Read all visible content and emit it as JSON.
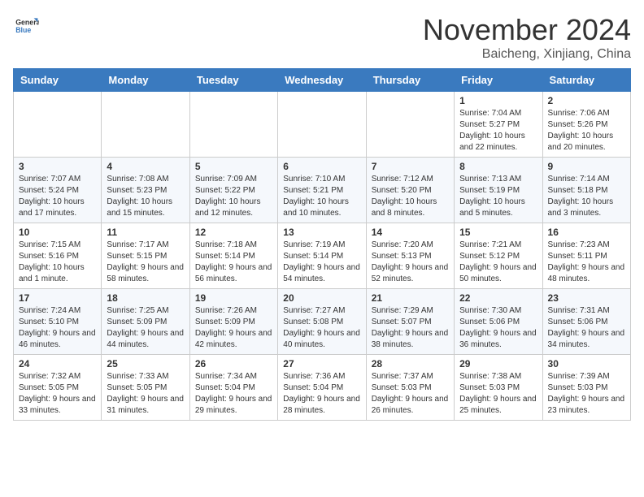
{
  "header": {
    "logo_general": "General",
    "logo_blue": "Blue",
    "month_title": "November 2024",
    "location": "Baicheng, Xinjiang, China"
  },
  "days_of_week": [
    "Sunday",
    "Monday",
    "Tuesday",
    "Wednesday",
    "Thursday",
    "Friday",
    "Saturday"
  ],
  "weeks": [
    [
      {
        "day": "",
        "info": ""
      },
      {
        "day": "",
        "info": ""
      },
      {
        "day": "",
        "info": ""
      },
      {
        "day": "",
        "info": ""
      },
      {
        "day": "",
        "info": ""
      },
      {
        "day": "1",
        "info": "Sunrise: 7:04 AM\nSunset: 5:27 PM\nDaylight: 10 hours and 22 minutes."
      },
      {
        "day": "2",
        "info": "Sunrise: 7:06 AM\nSunset: 5:26 PM\nDaylight: 10 hours and 20 minutes."
      }
    ],
    [
      {
        "day": "3",
        "info": "Sunrise: 7:07 AM\nSunset: 5:24 PM\nDaylight: 10 hours and 17 minutes."
      },
      {
        "day": "4",
        "info": "Sunrise: 7:08 AM\nSunset: 5:23 PM\nDaylight: 10 hours and 15 minutes."
      },
      {
        "day": "5",
        "info": "Sunrise: 7:09 AM\nSunset: 5:22 PM\nDaylight: 10 hours and 12 minutes."
      },
      {
        "day": "6",
        "info": "Sunrise: 7:10 AM\nSunset: 5:21 PM\nDaylight: 10 hours and 10 minutes."
      },
      {
        "day": "7",
        "info": "Sunrise: 7:12 AM\nSunset: 5:20 PM\nDaylight: 10 hours and 8 minutes."
      },
      {
        "day": "8",
        "info": "Sunrise: 7:13 AM\nSunset: 5:19 PM\nDaylight: 10 hours and 5 minutes."
      },
      {
        "day": "9",
        "info": "Sunrise: 7:14 AM\nSunset: 5:18 PM\nDaylight: 10 hours and 3 minutes."
      }
    ],
    [
      {
        "day": "10",
        "info": "Sunrise: 7:15 AM\nSunset: 5:16 PM\nDaylight: 10 hours and 1 minute."
      },
      {
        "day": "11",
        "info": "Sunrise: 7:17 AM\nSunset: 5:15 PM\nDaylight: 9 hours and 58 minutes."
      },
      {
        "day": "12",
        "info": "Sunrise: 7:18 AM\nSunset: 5:14 PM\nDaylight: 9 hours and 56 minutes."
      },
      {
        "day": "13",
        "info": "Sunrise: 7:19 AM\nSunset: 5:14 PM\nDaylight: 9 hours and 54 minutes."
      },
      {
        "day": "14",
        "info": "Sunrise: 7:20 AM\nSunset: 5:13 PM\nDaylight: 9 hours and 52 minutes."
      },
      {
        "day": "15",
        "info": "Sunrise: 7:21 AM\nSunset: 5:12 PM\nDaylight: 9 hours and 50 minutes."
      },
      {
        "day": "16",
        "info": "Sunrise: 7:23 AM\nSunset: 5:11 PM\nDaylight: 9 hours and 48 minutes."
      }
    ],
    [
      {
        "day": "17",
        "info": "Sunrise: 7:24 AM\nSunset: 5:10 PM\nDaylight: 9 hours and 46 minutes."
      },
      {
        "day": "18",
        "info": "Sunrise: 7:25 AM\nSunset: 5:09 PM\nDaylight: 9 hours and 44 minutes."
      },
      {
        "day": "19",
        "info": "Sunrise: 7:26 AM\nSunset: 5:09 PM\nDaylight: 9 hours and 42 minutes."
      },
      {
        "day": "20",
        "info": "Sunrise: 7:27 AM\nSunset: 5:08 PM\nDaylight: 9 hours and 40 minutes."
      },
      {
        "day": "21",
        "info": "Sunrise: 7:29 AM\nSunset: 5:07 PM\nDaylight: 9 hours and 38 minutes."
      },
      {
        "day": "22",
        "info": "Sunrise: 7:30 AM\nSunset: 5:06 PM\nDaylight: 9 hours and 36 minutes."
      },
      {
        "day": "23",
        "info": "Sunrise: 7:31 AM\nSunset: 5:06 PM\nDaylight: 9 hours and 34 minutes."
      }
    ],
    [
      {
        "day": "24",
        "info": "Sunrise: 7:32 AM\nSunset: 5:05 PM\nDaylight: 9 hours and 33 minutes."
      },
      {
        "day": "25",
        "info": "Sunrise: 7:33 AM\nSunset: 5:05 PM\nDaylight: 9 hours and 31 minutes."
      },
      {
        "day": "26",
        "info": "Sunrise: 7:34 AM\nSunset: 5:04 PM\nDaylight: 9 hours and 29 minutes."
      },
      {
        "day": "27",
        "info": "Sunrise: 7:36 AM\nSunset: 5:04 PM\nDaylight: 9 hours and 28 minutes."
      },
      {
        "day": "28",
        "info": "Sunrise: 7:37 AM\nSunset: 5:03 PM\nDaylight: 9 hours and 26 minutes."
      },
      {
        "day": "29",
        "info": "Sunrise: 7:38 AM\nSunset: 5:03 PM\nDaylight: 9 hours and 25 minutes."
      },
      {
        "day": "30",
        "info": "Sunrise: 7:39 AM\nSunset: 5:03 PM\nDaylight: 9 hours and 23 minutes."
      }
    ]
  ]
}
